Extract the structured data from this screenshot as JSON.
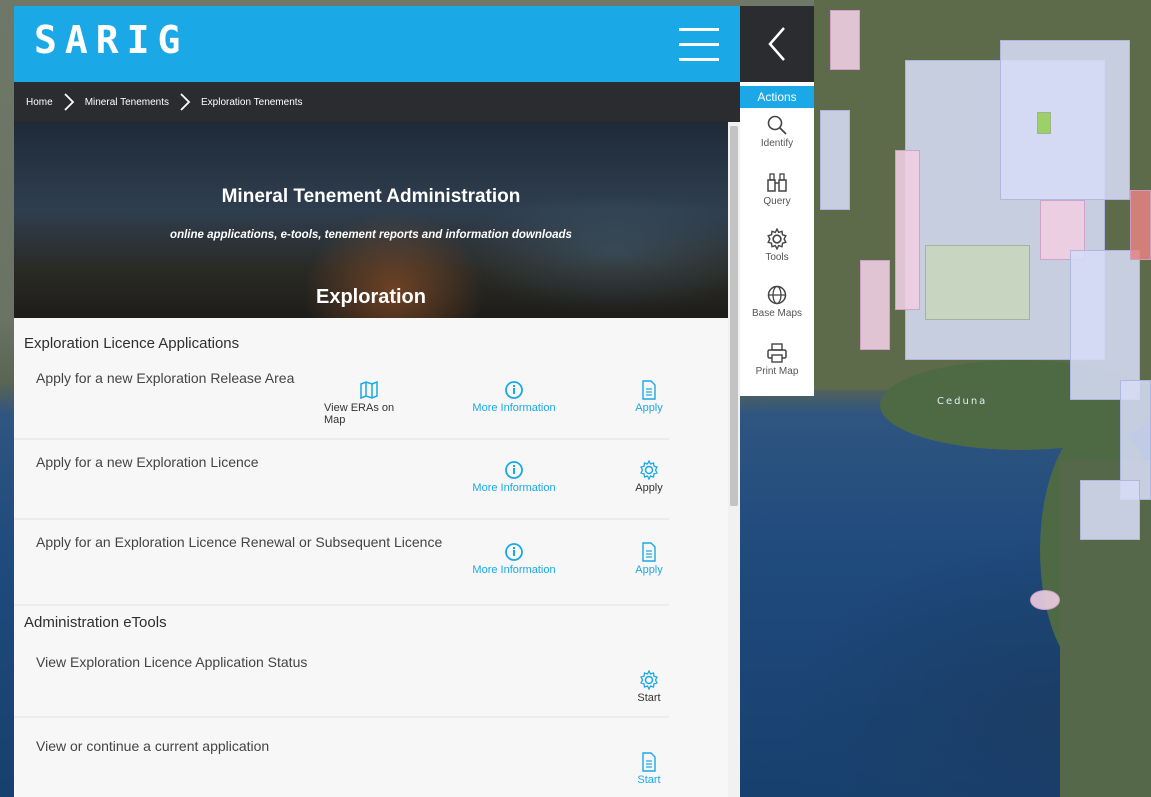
{
  "app": {
    "logo": "SARIG"
  },
  "breadcrumb": [
    "Home",
    "Mineral Tenements",
    "Exploration Tenements"
  ],
  "hero": {
    "title": "Mineral Tenement Administration",
    "subtitle": "online applications, e-tools, tenement reports and information downloads",
    "section": "Exploration"
  },
  "licence_section": {
    "heading": "Exploration Licence Applications",
    "rows": [
      {
        "text": "Apply for a new Exploration Release Area",
        "view_map": "View ERAs on Map",
        "more_info": "More Information",
        "apply": "Apply"
      },
      {
        "text": "Apply for a new Exploration Licence",
        "more_info": "More Information",
        "apply": "Apply"
      },
      {
        "text": "Apply for an Exploration Licence Renewal or Subsequent Licence",
        "more_info": "More Information",
        "apply": "Apply"
      }
    ]
  },
  "etools_section": {
    "heading": "Administration eTools",
    "rows": [
      {
        "text": "View Exploration Licence Application Status",
        "start": "Start"
      },
      {
        "text": "View or continue a current application",
        "start": "Start"
      }
    ]
  },
  "sidebar": {
    "title": "Actions",
    "items": [
      {
        "label": "Identify",
        "icon": "magnifier-icon"
      },
      {
        "label": "Query",
        "icon": "binoculars-icon"
      },
      {
        "label": "Tools",
        "icon": "gear-icon"
      },
      {
        "label": "Base Maps",
        "icon": "globe-icon"
      },
      {
        "label": "Print Map",
        "icon": "printer-icon"
      }
    ]
  },
  "map": {
    "place_label": "Ceduna"
  },
  "colors": {
    "brand": "#1aa9e6",
    "dark_bar": "#2a2c30",
    "link": "#1aa9e6"
  }
}
